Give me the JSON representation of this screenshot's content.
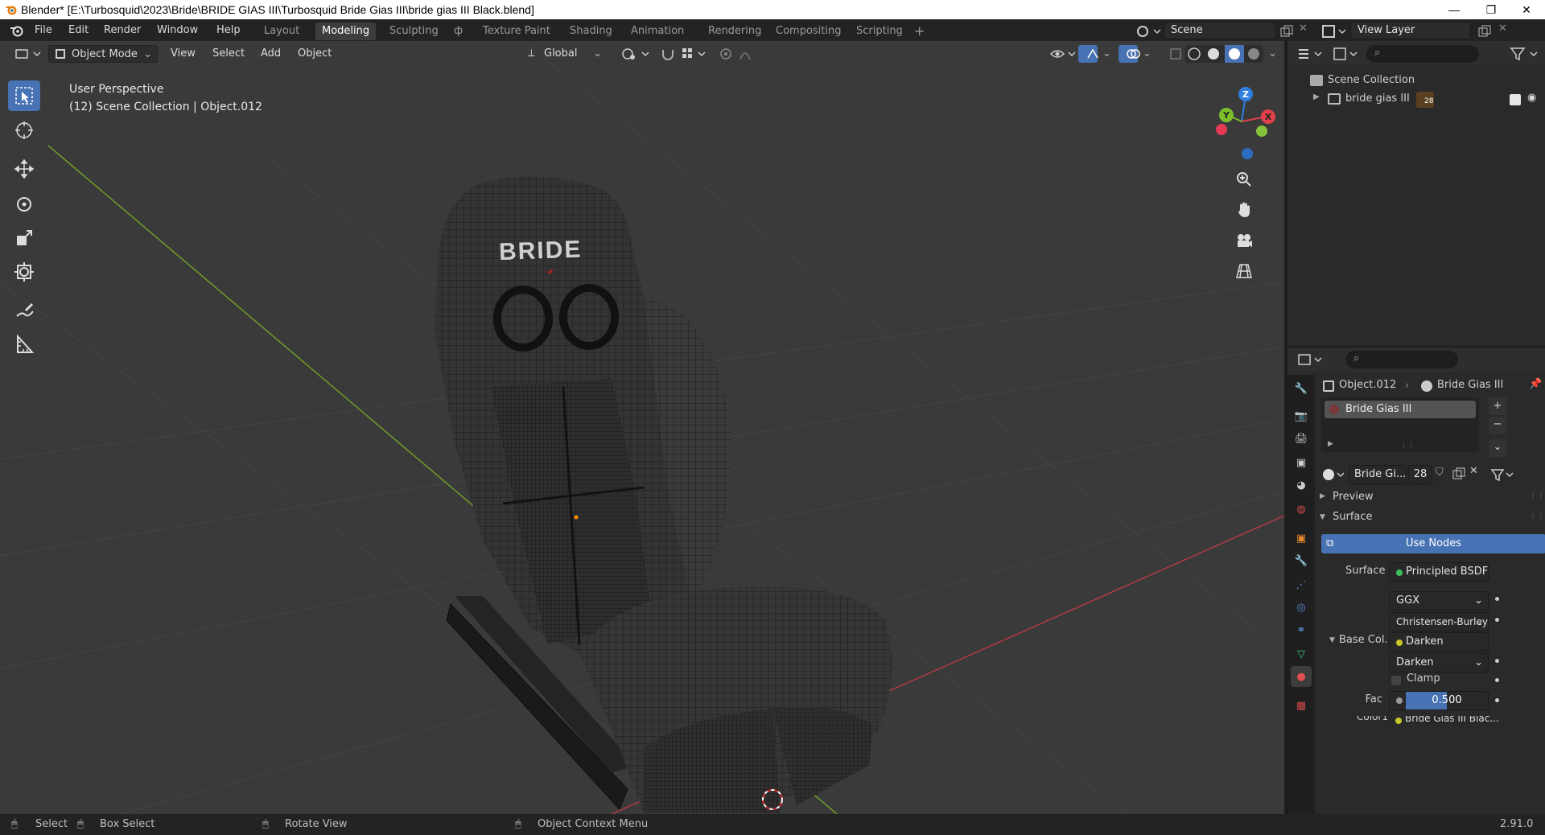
{
  "window": {
    "title": "Blender* [E:\\Turbosquid\\2023\\Bride\\BRIDE GIAS III\\Turbosquid Bride Gias III\\bride gias III Black.blend]",
    "minimize": "—",
    "maximize": "❐",
    "close": "✕"
  },
  "menu": {
    "file": "File",
    "edit": "Edit",
    "render": "Render",
    "window": "Window",
    "help": "Help"
  },
  "workspaces": [
    "Layout",
    "Modeling",
    "Sculpting",
    "UV Editing",
    "Texture Paint",
    "Shading",
    "Animation",
    "Rendering",
    "Compositing",
    "Scripting"
  ],
  "workspaces_display": {
    "layout": "Layout",
    "modeling": "Modeling",
    "sculpting": "Sculpting",
    "uv": "ф",
    "texture_paint": "Texture Paint",
    "shading": "Shading",
    "animation": "Animation",
    "rendering": "Rendering",
    "compositing": "Compositing",
    "scripting": "Scripting",
    "add": "+"
  },
  "scene": {
    "label": "Scene"
  },
  "view_layer": {
    "label": "View Layer"
  },
  "viewport_header": {
    "mode": "Object Mode",
    "view": "View",
    "select": "Select",
    "add": "Add",
    "object": "Object",
    "orientation": "Global"
  },
  "viewport_overlay": {
    "perspective": "User Perspective",
    "collection_info": "(12) Scene Collection | Object.012",
    "logo_text": "BRIDE"
  },
  "gizmo": {
    "x": "X",
    "y": "Y",
    "z": "Z"
  },
  "outliner": {
    "root": "Scene Collection",
    "items": [
      {
        "label": "bride gias III",
        "badge": "28"
      }
    ]
  },
  "properties": {
    "object_name": "Object.012",
    "material_name": "Bride Gias III",
    "slot_name": "Bride Gias III",
    "material_field": "Bride Gi...",
    "user_count": "28",
    "preview": "Preview",
    "surface_section": "Surface",
    "use_nodes": "Use Nodes",
    "surface_label": "Surface",
    "surface_value": "Principled BSDF",
    "distribution": "GGX",
    "subsurface_method": "Christensen-Burley",
    "base_color_label": "Base Col...",
    "base_color_value": "Darken",
    "blend_mode": "Darken",
    "clamp": "Clamp",
    "fac_label": "Fac",
    "fac_value": "0.500",
    "fac_fraction": 0.5,
    "color1_label": "Color1",
    "color1_value": "Bride Gias III Blac..."
  },
  "statusbar": {
    "select": "Select",
    "box_select": "Box Select",
    "rotate_view": "Rotate View",
    "context_menu": "Object Context Menu",
    "version": "2.91.0"
  },
  "colors": {
    "accent": "#4772b3",
    "viewport_bg": "#3a3a3a",
    "panel_bg": "#2a2a2a",
    "axis_x": "#e0404a",
    "axis_y": "#7cbf2a",
    "axis_z": "#2f7fe0"
  }
}
